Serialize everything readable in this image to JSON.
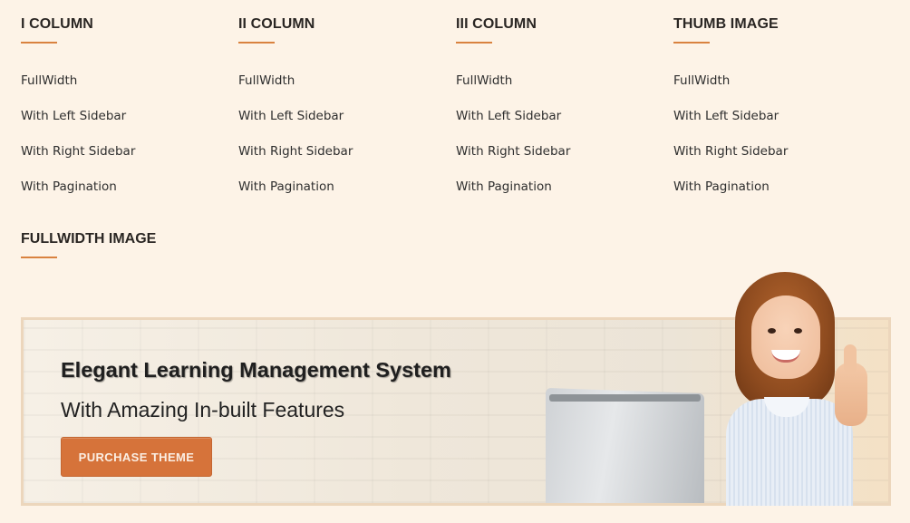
{
  "columns": [
    {
      "title": "I COLUMN",
      "links": [
        "FullWidth",
        "With Left Sidebar",
        "With Right Sidebar",
        "With Pagination"
      ]
    },
    {
      "title": "II COLUMN",
      "links": [
        "FullWidth",
        "With Left Sidebar",
        "With Right Sidebar",
        "With Pagination"
      ]
    },
    {
      "title": "III COLUMN",
      "links": [
        "FullWidth",
        "With Left Sidebar",
        "With Right Sidebar",
        "With Pagination"
      ]
    },
    {
      "title": "THUMB IMAGE",
      "links": [
        "FullWidth",
        "With Left Sidebar",
        "With Right Sidebar",
        "With Pagination"
      ]
    }
  ],
  "fullwidth": {
    "title": "FULLWIDTH IMAGE"
  },
  "banner": {
    "headline": "Elegant Learning Management System",
    "subline": "With Amazing In-built Features",
    "button_label": "PURCHASE THEME"
  },
  "colors": {
    "background": "#fdf3e7",
    "accent": "#d9823f",
    "button": "#d6733a",
    "banner_border": "#ecd6bc"
  }
}
